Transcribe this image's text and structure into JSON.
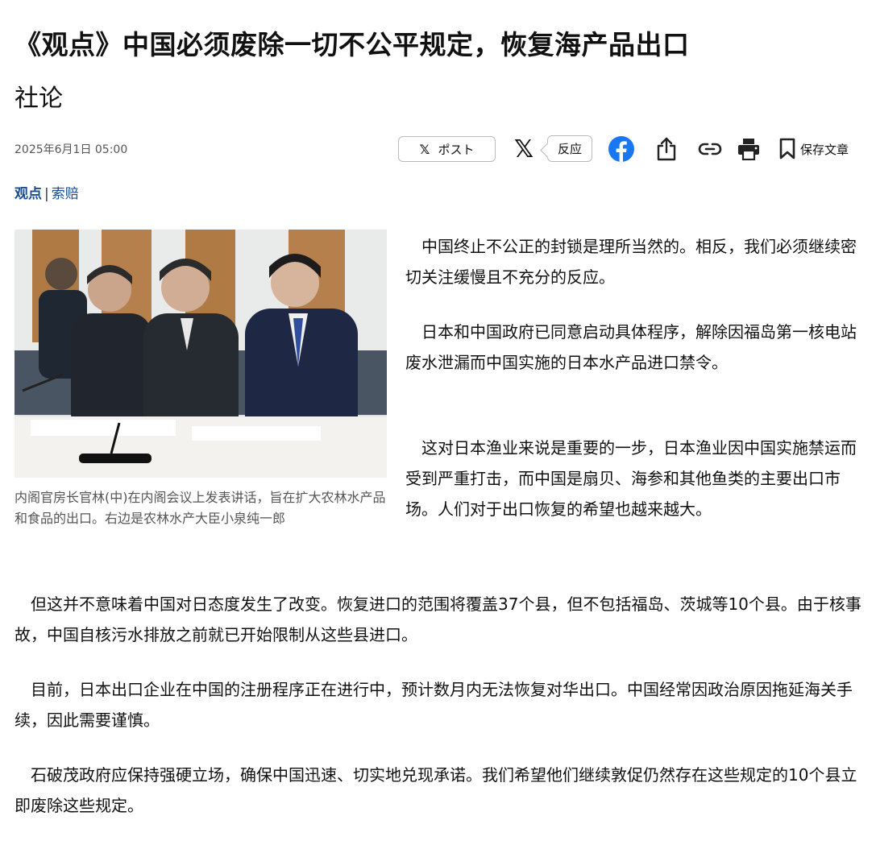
{
  "article": {
    "title": "《观点》中国必须废除一切不公平规定，恢复海产品出口",
    "section": "社论",
    "date": "2025年6月1日 05:00"
  },
  "share_bar": {
    "post_label": "ポスト",
    "reactions_label": "反应",
    "save_label": "保存文章",
    "icons": [
      "x-icon",
      "facebook-icon",
      "share-icon",
      "link-icon",
      "print-icon",
      "bookmark-icon"
    ],
    "colors": {
      "facebook": "#1877f2"
    }
  },
  "tags": {
    "main": "观点",
    "separator": "|",
    "sub": "索赔"
  },
  "photo": {
    "caption": "内阁官房长官林(中)在内阁会议上发表讲话，旨在扩大农林水产品和食品的出口。右边是农林水产大臣小泉纯一郎"
  },
  "body": {
    "p1": "中国终止不公正的封锁是理所当然的。相反，我们必须继续密切关注缓慢且不充分的反应。",
    "p2": "日本和中国政府已同意启动具体程序，解除因福岛第一核电站废水泄漏而中国实施的日本水产品进口禁令。",
    "p3": "这对日本渔业来说是重要的一步，日本渔业因中国实施禁运而受到严重打击，而中国是扇贝、海参和其他鱼类的主要出口市场。人们对于出口恢复的希望也越来越大。",
    "p4": "但这并不意味着中国对日态度发生了改变。恢复进口的范围将覆盖37个县，但不包括福岛、茨城等10个县。由于核事故，中国自核污水排放之前就已开始限制从这些县进口。",
    "p5": "目前，日本出口企业在中国的注册程序正在进行中，预计数月内无法恢复对华出口。中国经常因政治原因拖延海关手续，因此需要谨慎。",
    "p6": "石破茂政府应保持强硬立场，确保中国迅速、切实地兑现承诺。我们希望他们继续敦促仍然存在这些规定的10个县立即废除这些规定。"
  }
}
